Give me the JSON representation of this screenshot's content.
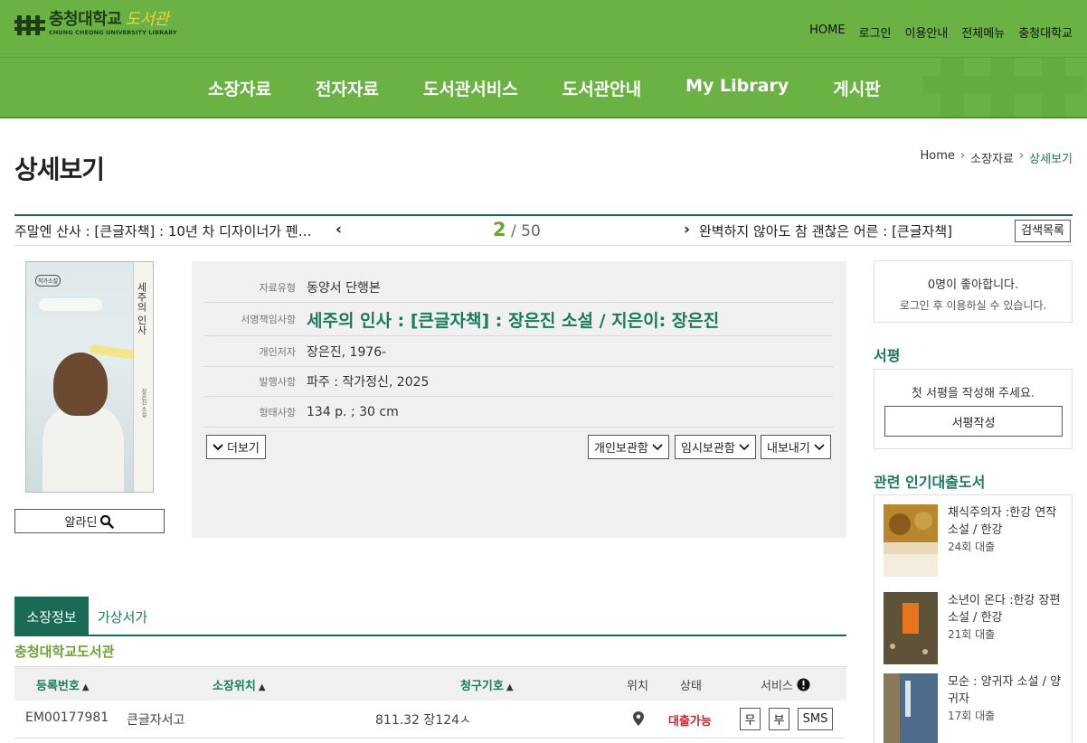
{
  "header": {
    "logo_main": "충청대학교",
    "logo_library": "도서관",
    "logo_sub": "CHUNG CHEONG UNIVERSITY LIBRARY",
    "util_nav": [
      "HOME",
      "로그인",
      "이용안내",
      "전체메뉴",
      "충청대학교"
    ],
    "main_nav": [
      "소장자료",
      "전자자료",
      "도서관서비스",
      "도서관안내",
      "My Library",
      "게시판"
    ]
  },
  "page": {
    "title": "상세보기",
    "breadcrumb": [
      "Home",
      "소장자료",
      "상세보기"
    ]
  },
  "record_nav": {
    "prev_title": "주말엔 산사 : [큰글자책] : 10년 차 디자이너가 펜…",
    "current": "2",
    "total": "/ 50",
    "next_title": "완벽하지 않아도 참 괜찮은 어른 : [큰글자책]",
    "list_button": "검색목록"
  },
  "cover": {
    "publisher_badge": "작가소설",
    "title": "세주의 인사",
    "author": "장은진 소설"
  },
  "alert_button": "알라딘",
  "info": {
    "rows": [
      {
        "key": "자료유형",
        "value": "동양서 단행본"
      },
      {
        "key": "서명책임사항",
        "value": "세주의 인사 : [큰글자책] : 장은진 소설 / 지은이: 장은진"
      },
      {
        "key": "개인저자",
        "value": "장은진, 1976-"
      },
      {
        "key": "발행사항",
        "value": "파주 : 작가정신, 2025"
      },
      {
        "key": "형태사항",
        "value": "134 p. ; 30 cm"
      }
    ],
    "more_button": "더보기",
    "personal_button": "개인보관함",
    "temp_button": "임시보관함",
    "export_button": "내보내기"
  },
  "sidebar": {
    "likes": "0명이 좋아합니다.",
    "login_hint": "로그인 후 이용하실 수 있습니다.",
    "review_heading": "서평",
    "review_message": "첫 서평을 작성해 주세요.",
    "review_button": "서평작성",
    "popular_heading": "관련 인기대출도서",
    "popular": [
      {
        "title": "채식주의자 :한강 연작소설 / 한강",
        "count": "24회 대출"
      },
      {
        "title": "소년이 온다 :한강 장편소설 / 한강",
        "count": "21회 대출"
      },
      {
        "title": "모순 : 양귀자 소설 / 양귀자",
        "count": "17회 대출"
      }
    ]
  },
  "holdings": {
    "tabs": [
      "소장정보",
      "가상서가"
    ],
    "library": "충청대학교도서관",
    "columns": [
      "등록번호",
      "소장위치",
      "청구기호",
      "위치",
      "상태",
      "서비스"
    ],
    "rows": [
      {
        "reg_no": "EM00177981",
        "location": "큰글자서고",
        "call_no": "811.32 장124ㅅ",
        "status": "대출가능",
        "services": [
          "무",
          "부",
          "SMS"
        ]
      }
    ]
  },
  "colors": {
    "header_green": "#69b243",
    "accent_teal": "#1a6b55",
    "status_available": "#c0282d"
  }
}
